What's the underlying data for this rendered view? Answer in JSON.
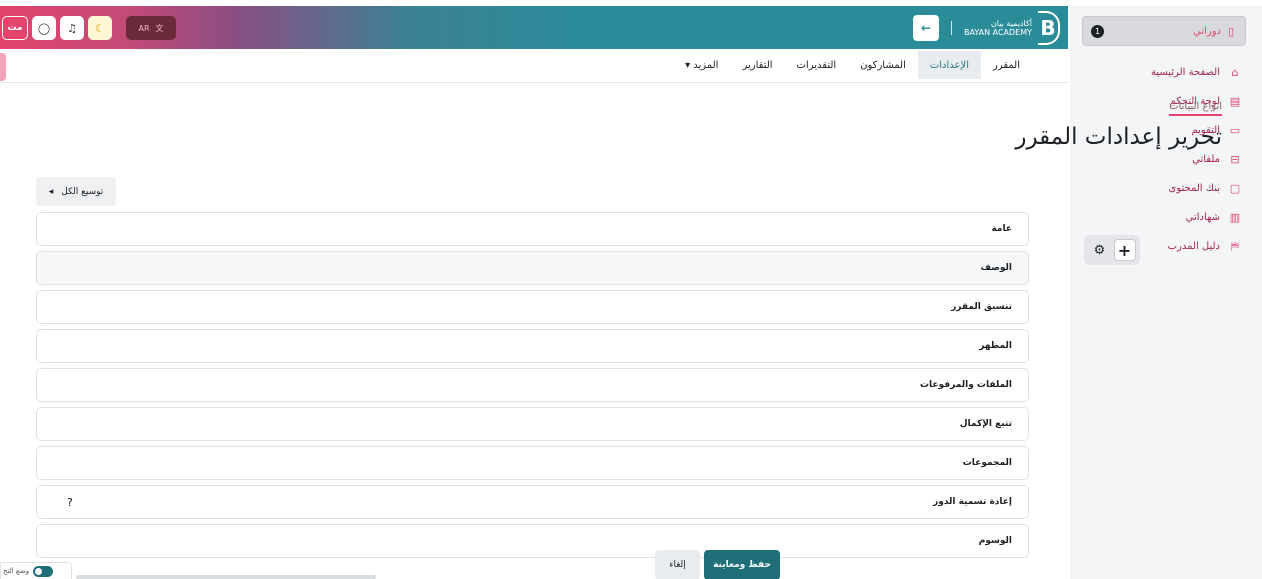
{
  "drawer": {
    "my_courses": {
      "label": "دوراتي",
      "badge": "1"
    },
    "items": [
      {
        "label": "الصفحة الرئيسية",
        "icon": "⌂"
      },
      {
        "label": "لوحة التحكم",
        "icon": "▤"
      },
      {
        "label": "التقويم",
        "icon": "▭"
      },
      {
        "label": "ملفاتي",
        "icon": "⊟"
      },
      {
        "label": "بنك المحتوى",
        "icon": "▢"
      },
      {
        "label": "شهاداتي",
        "icon": "▥"
      },
      {
        "label": "دليل المدرب",
        "icon": "⛿"
      }
    ],
    "dock": {
      "plus": "+",
      "gear": "⚙"
    }
  },
  "header": {
    "brand_name": "أكاديمية بيان",
    "brand_sub": "BAYAN ACADEMY",
    "logo_letter": "B",
    "back_icon": "←",
    "lang_label": "AR",
    "lang_icon": "文",
    "user_initials": "مت",
    "chat_icon": "◯",
    "bell_icon": "♫",
    "moon_icon": "☾"
  },
  "tabs": [
    {
      "label": "المقرر",
      "active": false
    },
    {
      "label": "الإعدادات",
      "active": true
    },
    {
      "label": "المشاركون",
      "active": false
    },
    {
      "label": "التقديرات",
      "active": false
    },
    {
      "label": "التقارير",
      "active": false
    },
    {
      "label": "المزيد ▾",
      "active": false
    }
  ],
  "main": {
    "breadcrumb": "انواع البيانات",
    "title": "تحرير إعدادات المقرر",
    "expand_all": "توسيع الكل",
    "expand_icon": "◂",
    "sections": [
      {
        "label": "عامة"
      },
      {
        "label": "الوصف"
      },
      {
        "label": "تنسيق المقرر"
      },
      {
        "label": "المظهر"
      },
      {
        "label": "الملفات والمرفوعات"
      },
      {
        "label": "تتبع الإكمال"
      },
      {
        "label": "المجموعات"
      },
      {
        "label": "إعادة تسمية الدور",
        "help": "?"
      },
      {
        "label": "الوسوم"
      }
    ],
    "cancel": "إلغاء",
    "save": "حفظ ومعاينة"
  },
  "footer": {
    "mode_label": "وضع التح"
  },
  "colors": {
    "accent": "#e2446c",
    "teal": "#2a8c99",
    "save": "#1f6f7a"
  }
}
